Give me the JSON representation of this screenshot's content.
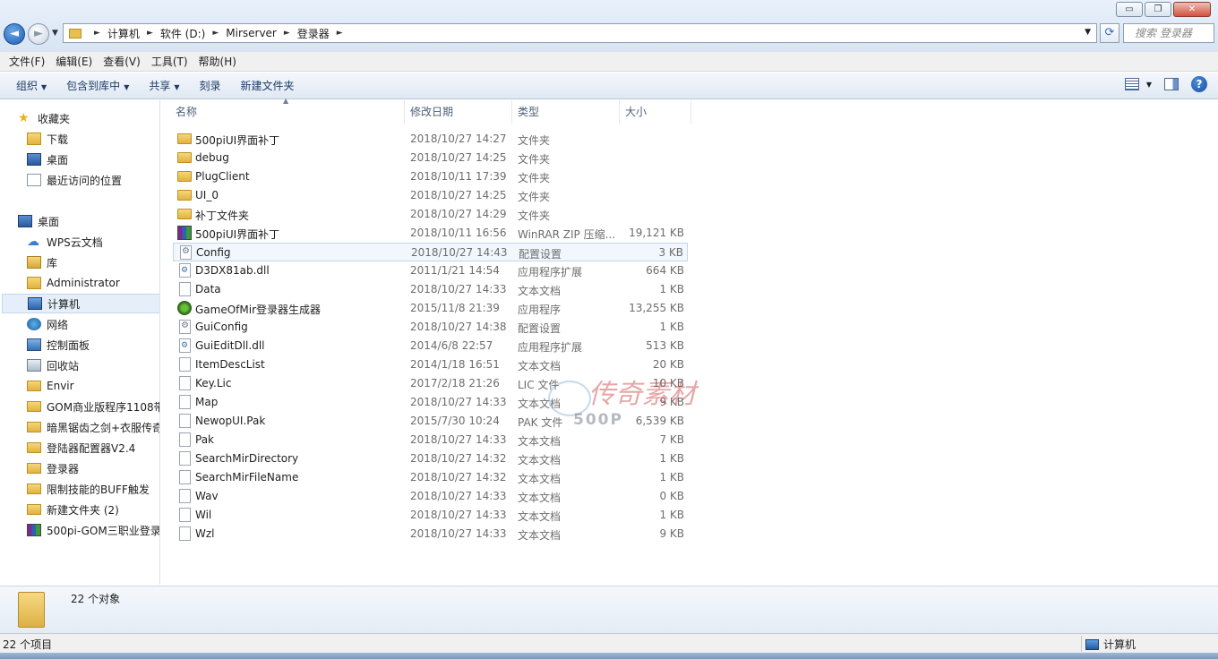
{
  "window": {
    "controls": {
      "minimize": "▭",
      "restore": "❐",
      "close": "✕"
    }
  },
  "navigation": {
    "back_glyph": "◄",
    "forward_glyph": "►",
    "breadcrumb": [
      "计算机",
      "软件 (D:)",
      "Mirserver",
      "登录器"
    ],
    "search_placeholder": "搜索 登录器"
  },
  "menu": [
    "文件(F)",
    "编辑(E)",
    "查看(V)",
    "工具(T)",
    "帮助(H)"
  ],
  "commands": {
    "organize": "组织",
    "include_library": "包含到库中",
    "share": "共享",
    "burn": "刻录",
    "new_folder": "新建文件夹",
    "help": "?"
  },
  "sidebar": {
    "favorites": [
      {
        "label": "收藏夹",
        "icon": "star-icon"
      },
      {
        "label": "下载",
        "icon": "download-folder-icon"
      },
      {
        "label": "桌面",
        "icon": "desktop-icon"
      },
      {
        "label": "最近访问的位置",
        "icon": "recent-places-icon"
      }
    ],
    "tree": [
      {
        "label": "桌面",
        "icon": "desktop-icon"
      },
      {
        "label": "WPS云文档",
        "icon": "cloud-icon"
      },
      {
        "label": "库",
        "icon": "library-icon"
      },
      {
        "label": "Administrator",
        "icon": "user-folder-icon"
      },
      {
        "label": "计算机",
        "icon": "computer-icon"
      },
      {
        "label": "网络",
        "icon": "network-icon"
      },
      {
        "label": "控制面板",
        "icon": "control-panel-icon"
      },
      {
        "label": "回收站",
        "icon": "recycle-bin-icon"
      },
      {
        "label": "Envir",
        "icon": "folder-icon"
      },
      {
        "label": "GOM商业版程序1108带",
        "icon": "folder-icon"
      },
      {
        "label": "暗黑锯齿之剑+衣服传奇",
        "icon": "folder-icon"
      },
      {
        "label": "登陆器配置器V2.4",
        "icon": "folder-icon"
      },
      {
        "label": "登录器",
        "icon": "folder-icon"
      },
      {
        "label": "限制技能的BUFF触发",
        "icon": "folder-icon"
      },
      {
        "label": "新建文件夹 (2)",
        "icon": "folder-icon"
      },
      {
        "label": "500pi-GOM三职业登录",
        "icon": "rar-icon"
      }
    ]
  },
  "columns": {
    "name": "名称",
    "modified": "修改日期",
    "type": "类型",
    "size": "大小"
  },
  "files": [
    {
      "name": "500piUI界面补丁",
      "modified": "2018/10/27 14:27",
      "type": "文件夹",
      "size": "",
      "icon": "folder-icon"
    },
    {
      "name": "debug",
      "modified": "2018/10/27 14:25",
      "type": "文件夹",
      "size": "",
      "icon": "folder-icon"
    },
    {
      "name": "PlugClient",
      "modified": "2018/10/11 17:39",
      "type": "文件夹",
      "size": "",
      "icon": "folder-icon"
    },
    {
      "name": "UI_0",
      "modified": "2018/10/27 14:25",
      "type": "文件夹",
      "size": "",
      "icon": "folder-icon"
    },
    {
      "name": "补丁文件夹",
      "modified": "2018/10/27 14:29",
      "type": "文件夹",
      "size": "",
      "icon": "folder-icon"
    },
    {
      "name": "500piUI界面补丁",
      "modified": "2018/10/11 16:56",
      "type": "WinRAR ZIP 压缩...",
      "size": "19,121 KB",
      "icon": "winrar-zip-icon"
    },
    {
      "name": "Config",
      "modified": "2018/10/27 14:43",
      "type": "配置设置",
      "size": "3 KB",
      "icon": "settings-file-icon"
    },
    {
      "name": "D3DX81ab.dll",
      "modified": "2011/1/21 14:54",
      "type": "应用程序扩展",
      "size": "664 KB",
      "icon": "dll-file-icon"
    },
    {
      "name": "Data",
      "modified": "2018/10/27 14:33",
      "type": "文本文档",
      "size": "1 KB",
      "icon": "text-file-icon"
    },
    {
      "name": "GameOfMir登录器生成器",
      "modified": "2015/11/8 21:39",
      "type": "应用程序",
      "size": "13,255 KB",
      "icon": "application-icon"
    },
    {
      "name": "GuiConfig",
      "modified": "2018/10/27 14:38",
      "type": "配置设置",
      "size": "1 KB",
      "icon": "settings-file-icon"
    },
    {
      "name": "GuiEditDll.dll",
      "modified": "2014/6/8 22:57",
      "type": "应用程序扩展",
      "size": "513 KB",
      "icon": "dll-file-icon"
    },
    {
      "name": "ItemDescList",
      "modified": "2014/1/18 16:51",
      "type": "文本文档",
      "size": "20 KB",
      "icon": "text-file-icon"
    },
    {
      "name": "Key.Lic",
      "modified": "2017/2/18 21:26",
      "type": "LIC 文件",
      "size": "10 KB",
      "icon": "generic-file-icon"
    },
    {
      "name": "Map",
      "modified": "2018/10/27 14:33",
      "type": "文本文档",
      "size": "9 KB",
      "icon": "text-file-icon"
    },
    {
      "name": "NewopUI.Pak",
      "modified": "2015/7/30 10:24",
      "type": "PAK 文件",
      "size": "6,539 KB",
      "icon": "generic-file-icon"
    },
    {
      "name": "Pak",
      "modified": "2018/10/27 14:33",
      "type": "文本文档",
      "size": "7 KB",
      "icon": "text-file-icon"
    },
    {
      "name": "SearchMirDirectory",
      "modified": "2018/10/27 14:32",
      "type": "文本文档",
      "size": "1 KB",
      "icon": "text-file-icon"
    },
    {
      "name": "SearchMirFileName",
      "modified": "2018/10/27 14:32",
      "type": "文本文档",
      "size": "1 KB",
      "icon": "text-file-icon"
    },
    {
      "name": "Wav",
      "modified": "2018/10/27 14:33",
      "type": "文本文档",
      "size": "0 KB",
      "icon": "text-file-icon"
    },
    {
      "name": "Wil",
      "modified": "2018/10/27 14:33",
      "type": "文本文档",
      "size": "1 KB",
      "icon": "text-file-icon"
    },
    {
      "name": "Wzl",
      "modified": "2018/10/27 14:33",
      "type": "文本文档",
      "size": "9 KB",
      "icon": "text-file-icon"
    }
  ],
  "watermark": {
    "logo": "传奇素材",
    "sub": "500P"
  },
  "details": {
    "count_text": "22 个对象"
  },
  "status": {
    "left": "22 个项目",
    "right": "计算机"
  },
  "colors": {
    "selection": "#e5eef9",
    "hover": "#f2f7fd",
    "header_text": "#4c607a"
  }
}
